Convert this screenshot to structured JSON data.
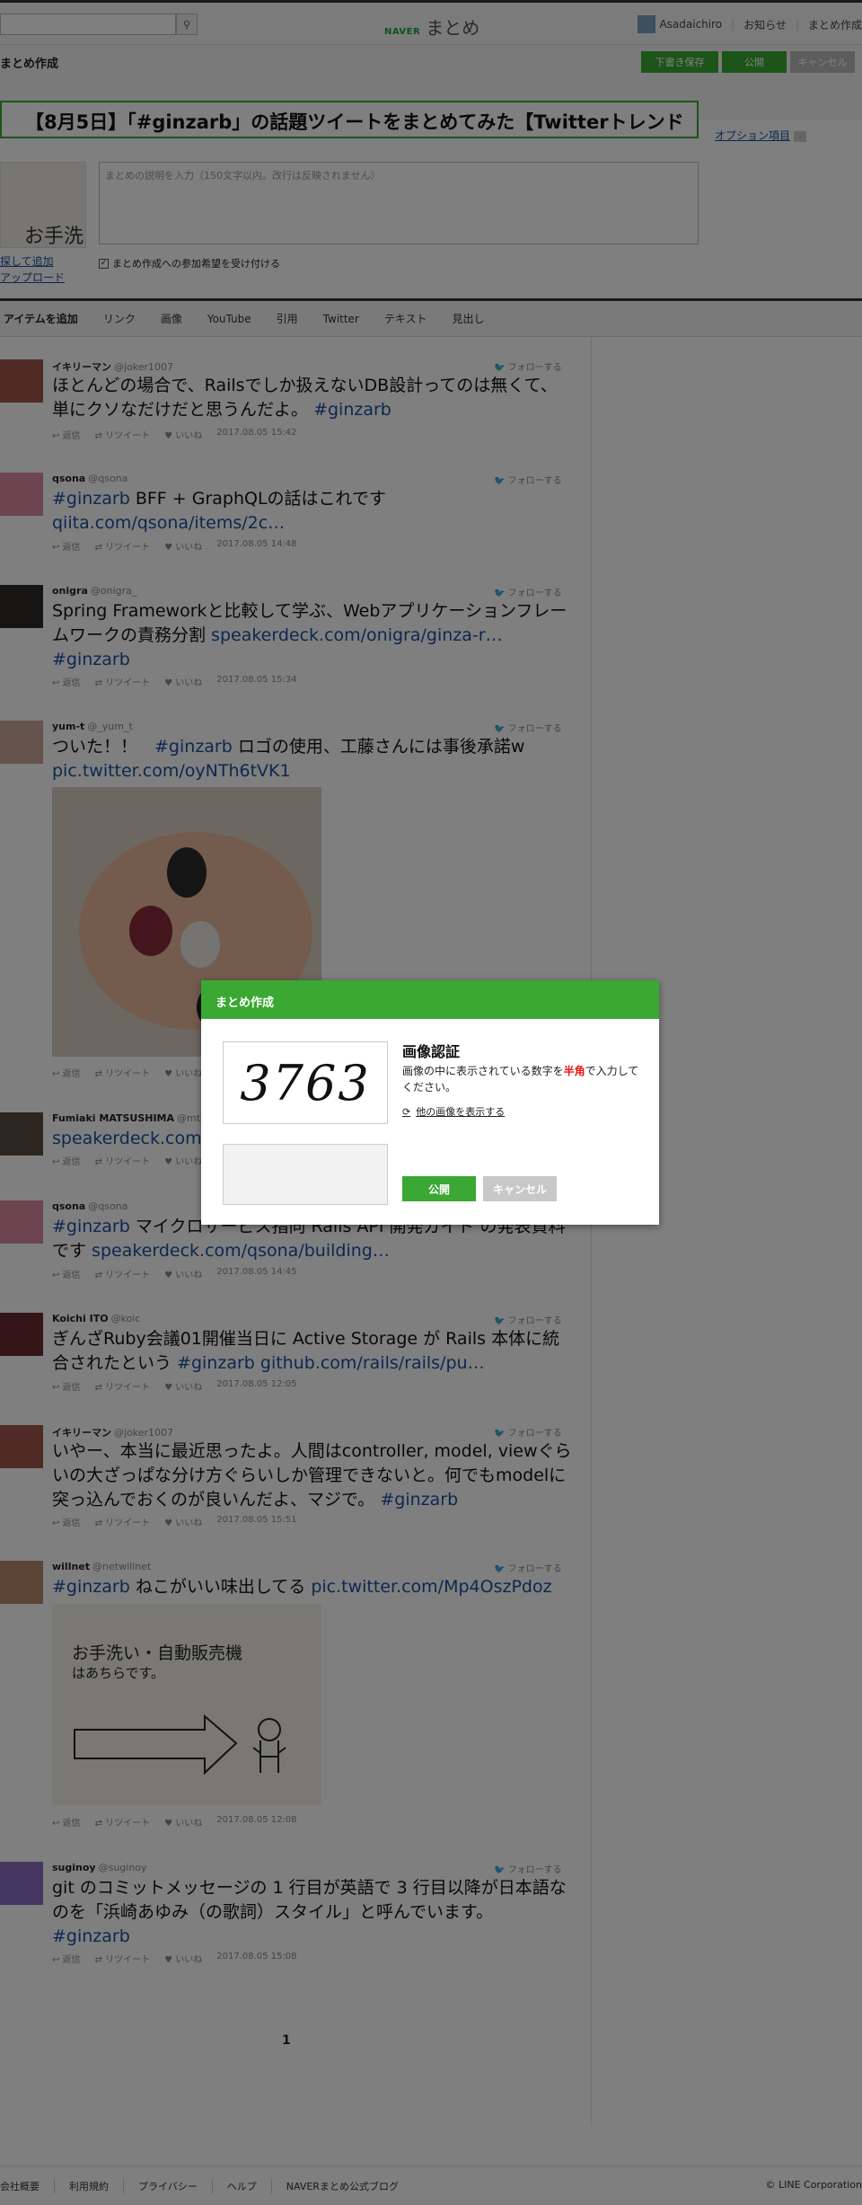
{
  "header": {
    "logo_brand": "NAVER",
    "logo_text": "まとめ",
    "username": "Asadaichiro",
    "notifications": "お知らせ",
    "create": "まとめ作成"
  },
  "create": {
    "page_title": "まとめ作成",
    "draft_button": "下書き保存",
    "publish_button": "公開",
    "cancel_button": "キャンセル",
    "title_value": "【8月5日】「#ginzarb」の話題ツイートをまとめてみた【Twitterトレンド",
    "option_link": "オプション項目",
    "description_placeholder": "まとめの説明を入力（150文字以内。改行は反映されません）",
    "thumb_text": "お手洗",
    "thumb_link_add": "探して追加",
    "thumb_link_upload": "アップロード",
    "participation_label": "まとめ作成への参加希望を受け付ける"
  },
  "itembar": {
    "label": "アイテムを追加",
    "items": [
      "リンク",
      "画像",
      "YouTube",
      "引用",
      "Twitter",
      "テキスト",
      "見出し"
    ]
  },
  "tweet_actions": {
    "reply": "返信",
    "retweet": "リツイート",
    "like": "いいね",
    "follow": "フォローする"
  },
  "tweets": [
    {
      "name": "イキリーマン",
      "handle": "@joker1007",
      "text": "ほとんどの場合で、Railsでしか扱えないDB設計ってのは無くて、単にクソなだけだと思うんだよ。",
      "tag": "#ginzarb",
      "date": "2017.08.05 15:42"
    },
    {
      "name": "qsona",
      "handle": "@qsona",
      "tag": "#ginzarb",
      "text": " BFF + GraphQLの話はこれです ",
      "link": "qiita.com/qsona/items/2c…",
      "date": "2017.08.05 14:48"
    },
    {
      "name": "onigra",
      "handle": "@onigra_",
      "text": "Spring Frameworkと比較して学ぶ、Webアプリケーションフレームワークの責務分割 ",
      "link": "speakerdeck.com/onigra/ginza-r…",
      "tag": "#ginzarb",
      "date": "2017.08.05 15:34"
    },
    {
      "name": "yum-t",
      "handle": "@_yum_t",
      "text": "ついた！！　",
      "tag": "#ginzarb",
      "text2": " ロゴの使用、工藤さんには事後承諾w ",
      "link": "pic.twitter.com/oyNTh6tVK1",
      "date": ""
    },
    {
      "name": "Fumiaki MATSUSHIMA",
      "handle": "@mtsmfm",
      "link": "speakerdeck.com/m…",
      "date": ""
    },
    {
      "name": "qsona",
      "handle": "@qsona",
      "tag": "#ginzarb",
      "text": " マイクロサービス指向 Rails API 開発ガイド の発表資料です ",
      "link": "speakerdeck.com/qsona/building…",
      "date": "2017.08.05 14:45"
    },
    {
      "name": "Koichi ITO",
      "handle": "@koic",
      "text": "ぎんざRuby会議01開催当日に Active Storage が Rails 本体に統合されたという ",
      "tag": "#ginzarb",
      "link": " github.com/rails/rails/pu…",
      "date": "2017.08.05 12:05"
    },
    {
      "name": "イキリーマン",
      "handle": "@joker1007",
      "text": "いやー、本当に最近思ったよ。人間はcontroller, model, viewぐらいの大ざっぱな分け方ぐらいしか管理できないと。何でもmodelに突っ込んでおくのが良いんだよ、マジで。 ",
      "tag": "#ginzarb",
      "date": "2017.08.05 15:51"
    },
    {
      "name": "willnet",
      "handle": "@netwillnet",
      "tag": "#ginzarb",
      "text": " ねこがいい味出してる ",
      "link": "pic.twitter.com/Mp4OszPdoz",
      "img_text1": "お手洗い・自動販売機",
      "img_text2": "はあちらです。",
      "date": "2017.08.05 12:08"
    },
    {
      "name": "suginoy",
      "handle": "@suginoy",
      "text": "git のコミットメッセージの 1 行目が英語で 3 行目以降が日本語なのを「浜崎あゆみ（の歌詞）スタイル」と呼んでいます。",
      "tag": "#ginzarb",
      "date": "2017.08.05 15:08"
    }
  ],
  "pager": {
    "current": "1"
  },
  "footer": {
    "links": [
      "会社概要",
      "利用規約",
      "プライバシー",
      "ヘルプ",
      "NAVERまとめ公式ブログ"
    ],
    "copyright": "© LINE Corporation"
  },
  "modal": {
    "header": "まとめ作成",
    "captcha_value": "3763",
    "title": "画像認証",
    "text_before": "画像の中に表示されている数字を",
    "text_red": "半角",
    "text_after": "で入力してください。",
    "other_image_link": "他の画像を表示する",
    "publish": "公開",
    "cancel": "キャンセル"
  }
}
